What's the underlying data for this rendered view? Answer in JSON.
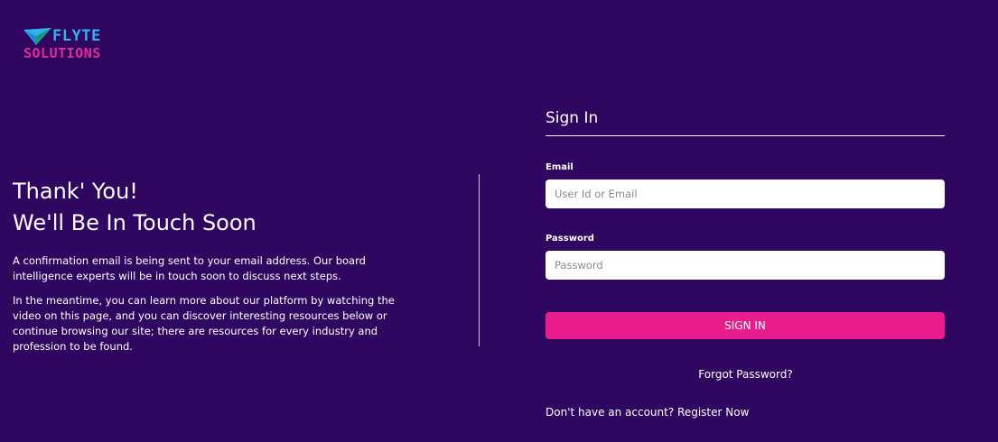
{
  "logo": {
    "line1": "FLYTE",
    "line2": "SOLUTIONS",
    "icon": "paper-plane-icon",
    "colors": {
      "primary": "#2fb3ea",
      "secondary": "#e5289c"
    }
  },
  "message": {
    "heading_line1": "Thank' You!",
    "heading_line2": "We'll Be In Touch Soon",
    "paragraph1": "A confirmation email is being sent to your email address. Our board intelligence experts will be in touch soon to discuss next steps.",
    "paragraph2": "In the meantime, you can learn more about our platform by watching the video on this page, and you can discover interesting resources below or continue browsing our site; there are resources for every industry and profession to be found."
  },
  "signin": {
    "title": "Sign In",
    "email_label": "Email",
    "email_placeholder": "User Id or Email",
    "email_value": "",
    "password_label": "Password",
    "password_placeholder": "Password",
    "password_value": "",
    "button_label": "SIGN IN",
    "forgot_label": "Forgot Password?",
    "register_prompt": "Don't have an account?",
    "register_label": "Register Now"
  },
  "colors": {
    "background": "#2f0760",
    "accent": "#e91e8c",
    "text": "#ffffff"
  }
}
